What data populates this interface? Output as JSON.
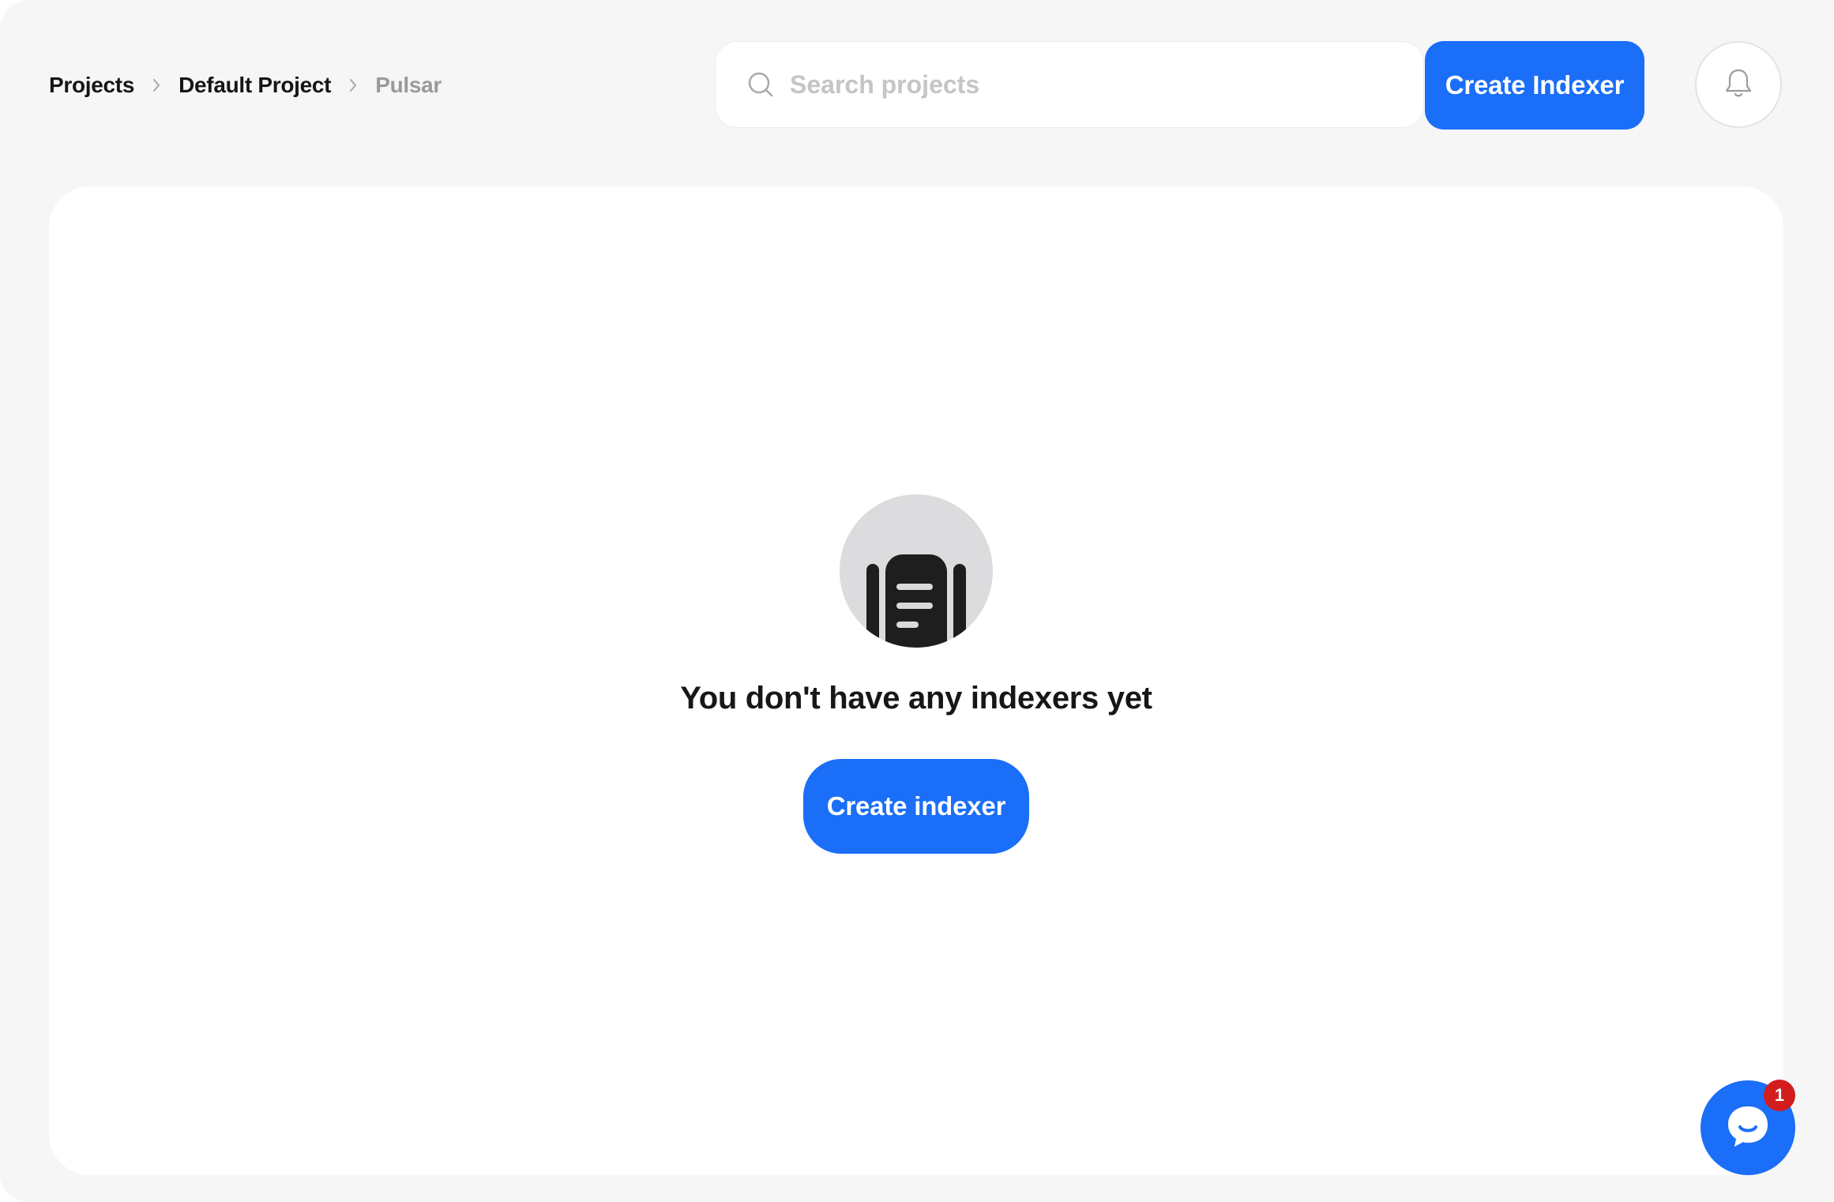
{
  "breadcrumb": {
    "items": [
      {
        "label": "Projects"
      },
      {
        "label": "Default Project"
      },
      {
        "label": "Pulsar"
      }
    ]
  },
  "search": {
    "placeholder": "Search projects",
    "value": "",
    "icon": "search-icon"
  },
  "header": {
    "create_button_label": "Create Indexer",
    "bell_icon": "bell-icon"
  },
  "empty_state": {
    "icon": "indexer-document-icon",
    "title": "You don't have any indexers yet",
    "button_label": "Create indexer"
  },
  "chat": {
    "icon": "chat-icon",
    "badge_count": "1"
  },
  "colors": {
    "accent": "#1a6ef8",
    "background": "#f6f6f6",
    "badge": "#d31d1d"
  }
}
